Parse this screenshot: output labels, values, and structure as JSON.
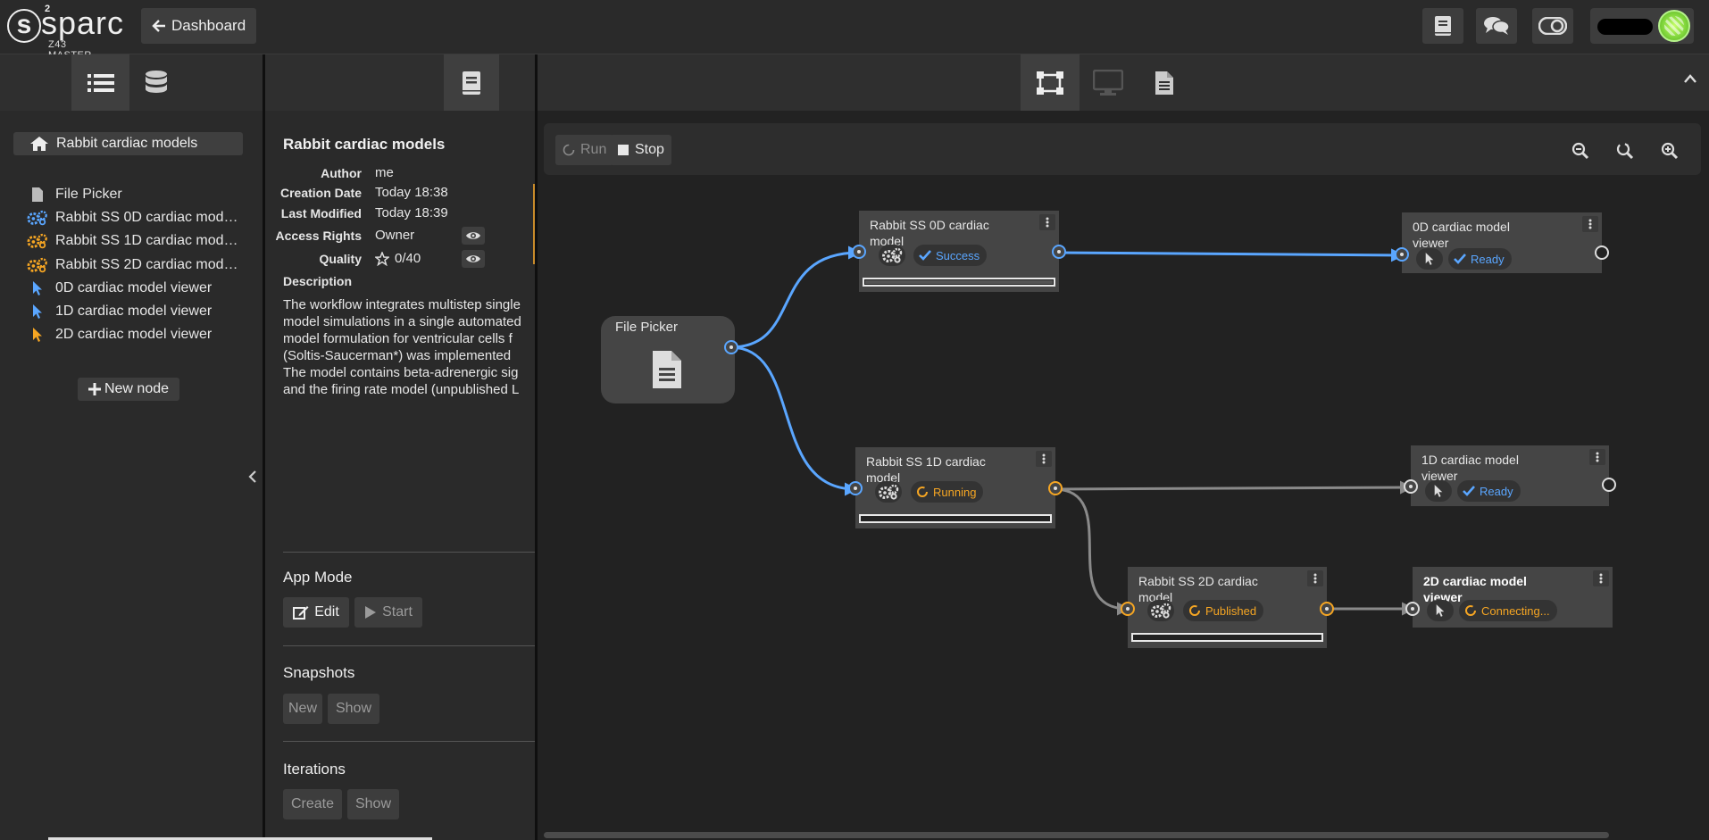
{
  "app": {
    "logo_text": "sparc",
    "logo_superscript": "2",
    "logo_subtitle": "Z43 MASTER",
    "dashboard_button": "Dashboard"
  },
  "topbar_icons": [
    "book-icon",
    "chat-icon",
    "toggle-icon"
  ],
  "left_tabs": [
    "list-icon",
    "database-icon"
  ],
  "info_tab": "book-icon",
  "workbench_tabs": [
    "workbench-icon",
    "monitor-icon",
    "document-icon"
  ],
  "colors": {
    "accent_blue": "#5aa6ff",
    "accent_orange": "#f6a623",
    "edge_gray": "#8a8a8a"
  },
  "tree": {
    "root": "Rabbit cardiac models",
    "items": [
      {
        "label": "File Picker",
        "icon": "file-icon"
      },
      {
        "label": "Rabbit SS 0D cardiac mod…",
        "icon": "gears-icon-blue"
      },
      {
        "label": "Rabbit SS 1D cardiac mod…",
        "icon": "gears-icon-orange"
      },
      {
        "label": "Rabbit SS 2D cardiac mod…",
        "icon": "gears-icon-orange"
      },
      {
        "label": "0D cardiac model viewer",
        "icon": "pointer-icon-blue"
      },
      {
        "label": "1D cardiac model viewer",
        "icon": "pointer-icon-blue"
      },
      {
        "label": "2D cardiac model viewer",
        "icon": "pointer-icon-orange"
      }
    ],
    "new_node": "New node"
  },
  "info": {
    "title": "Rabbit cardiac models",
    "author_label": "Author",
    "author": "me",
    "creation_label": "Creation Date",
    "creation": "Today 18:38",
    "modified_label": "Last Modified",
    "modified": "Today 18:39",
    "access_label": "Access Rights",
    "access": "Owner",
    "quality_label": "Quality",
    "quality": "0/40",
    "description_label": "Description",
    "description_lines": [
      "The workflow integrates multistep single",
      "model simulations in a single automated",
      "model formulation for ventricular cells f",
      "(Soltis-Saucerman*) was implemented",
      "The model contains beta-adrenergic sig",
      "and the firing rate model (unpublished L"
    ],
    "app_mode_title": "App Mode",
    "edit_button": "Edit",
    "start_button": "Start",
    "snapshots_title": "Snapshots",
    "snap_new": "New",
    "snap_show": "Show",
    "iterations_title": "Iterations",
    "iter_create": "Create",
    "iter_show": "Show"
  },
  "toolbar": {
    "run": "Run",
    "stop": "Stop"
  },
  "nodes": {
    "file_picker": {
      "title": "File Picker"
    },
    "ss0d": {
      "title_1": "Rabbit SS 0D cardiac",
      "title_2": "model",
      "status": "Success"
    },
    "ss1d": {
      "title_1": "Rabbit SS 1D cardiac",
      "title_2": "model",
      "status": "Running"
    },
    "ss2d": {
      "title_1": "Rabbit SS 2D cardiac",
      "title_2": "model",
      "status": "Published"
    },
    "v0d": {
      "title_1": "0D cardiac model",
      "title_2": "viewer",
      "status": "Ready"
    },
    "v1d": {
      "title_1": "1D cardiac model",
      "title_2": "viewer",
      "status": "Ready"
    },
    "v2d": {
      "title_1": "2D cardiac model",
      "title_2": "viewer",
      "status": "Connecting..."
    }
  }
}
